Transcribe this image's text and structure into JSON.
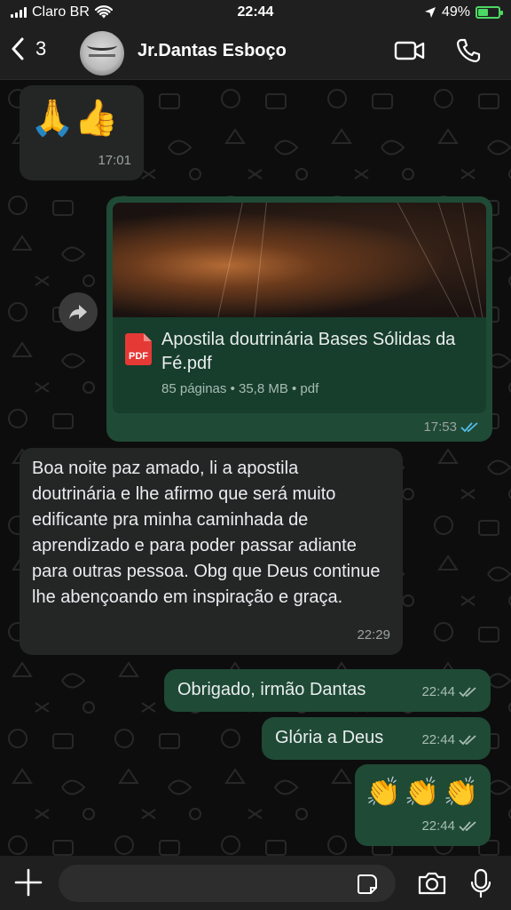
{
  "status": {
    "carrier": "Claro BR",
    "time": "22:44",
    "battery": "49%",
    "battery_level": 0.49
  },
  "header": {
    "back_count": "3",
    "contact_name": "Jr.Dantas Esboço"
  },
  "messages": {
    "m1": {
      "emojis": "🙏👍",
      "time": "17:01"
    },
    "doc": {
      "file_name": "Apostila doutrinária  Bases Sólidas da Fé.pdf",
      "pdf_label": "PDF",
      "meta": "85 páginas • 35,8 MB • pdf",
      "time": "17:53"
    },
    "m3": {
      "text": "Boa noite paz amado, li a apostila doutrinária e lhe afirmo que será muito edificante pra minha caminhada de aprendizado e para poder passar adiante para outras pessoa. Obg que Deus continue lhe abençoando em inspiração e graça.",
      "time": "22:29"
    },
    "m4": {
      "text": "Obrigado, irmão Dantas",
      "time": "22:44"
    },
    "m5": {
      "text": "Glória a Deus",
      "time": "22:44"
    },
    "m6": {
      "emojis": "👏👏👏",
      "time": "22:44"
    }
  },
  "composer": {
    "placeholder": ""
  },
  "colors": {
    "outgoing": "#1f4a36",
    "incoming": "#242626",
    "read_ticks": "#53bdeb",
    "battery": "#4cd964"
  }
}
